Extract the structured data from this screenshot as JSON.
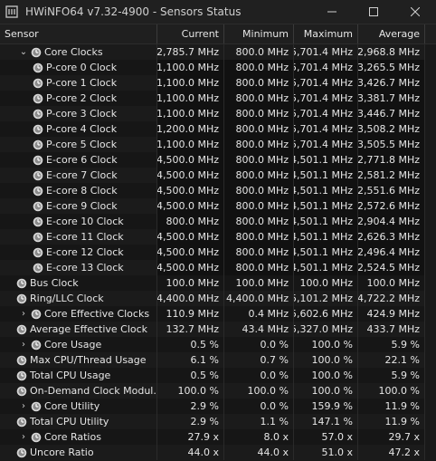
{
  "window": {
    "title": "HWiNFO64 v7.32-4900 - Sensors Status"
  },
  "columns": [
    "Sensor",
    "Current",
    "Minimum",
    "Maximum",
    "Average"
  ],
  "rows": [
    {
      "name": "Core Clocks",
      "cur": "2,785.7 MHz",
      "min": "800.0 MHz",
      "max": "5,701.4 MHz",
      "avg": "2,968.8 MHz",
      "indent": 1,
      "exp": "v",
      "icon": "clock"
    },
    {
      "name": "P-core 0 Clock",
      "cur": "1,100.0 MHz",
      "min": "800.0 MHz",
      "max": "5,701.4 MHz",
      "avg": "3,265.5 MHz",
      "indent": 2,
      "exp": "",
      "icon": "clock"
    },
    {
      "name": "P-core 1 Clock",
      "cur": "1,100.0 MHz",
      "min": "800.0 MHz",
      "max": "5,701.4 MHz",
      "avg": "3,426.7 MHz",
      "indent": 2,
      "exp": "",
      "icon": "clock"
    },
    {
      "name": "P-core 2 Clock",
      "cur": "1,100.0 MHz",
      "min": "800.0 MHz",
      "max": "5,701.4 MHz",
      "avg": "3,381.7 MHz",
      "indent": 2,
      "exp": "",
      "icon": "clock"
    },
    {
      "name": "P-core 3 Clock",
      "cur": "1,100.0 MHz",
      "min": "800.0 MHz",
      "max": "5,701.4 MHz",
      "avg": "3,446.7 MHz",
      "indent": 2,
      "exp": "",
      "icon": "clock"
    },
    {
      "name": "P-core 4 Clock",
      "cur": "1,200.0 MHz",
      "min": "800.0 MHz",
      "max": "5,701.4 MHz",
      "avg": "3,508.2 MHz",
      "indent": 2,
      "exp": "",
      "icon": "clock"
    },
    {
      "name": "P-core 5 Clock",
      "cur": "1,100.0 MHz",
      "min": "800.0 MHz",
      "max": "5,701.4 MHz",
      "avg": "3,505.5 MHz",
      "indent": 2,
      "exp": "",
      "icon": "clock"
    },
    {
      "name": "E-core 6 Clock",
      "cur": "4,500.0 MHz",
      "min": "800.0 MHz",
      "max": "4,501.1 MHz",
      "avg": "2,771.8 MHz",
      "indent": 2,
      "exp": "",
      "icon": "clock"
    },
    {
      "name": "E-core 7 Clock",
      "cur": "4,500.0 MHz",
      "min": "800.0 MHz",
      "max": "4,501.1 MHz",
      "avg": "2,581.2 MHz",
      "indent": 2,
      "exp": "",
      "icon": "clock"
    },
    {
      "name": "E-core 8 Clock",
      "cur": "4,500.0 MHz",
      "min": "800.0 MHz",
      "max": "4,501.1 MHz",
      "avg": "2,551.6 MHz",
      "indent": 2,
      "exp": "",
      "icon": "clock"
    },
    {
      "name": "E-core 9 Clock",
      "cur": "4,500.0 MHz",
      "min": "800.0 MHz",
      "max": "4,501.1 MHz",
      "avg": "2,572.6 MHz",
      "indent": 2,
      "exp": "",
      "icon": "clock"
    },
    {
      "name": "E-core 10 Clock",
      "cur": "800.0 MHz",
      "min": "800.0 MHz",
      "max": "4,501.1 MHz",
      "avg": "2,904.4 MHz",
      "indent": 2,
      "exp": "",
      "icon": "clock"
    },
    {
      "name": "E-core 11 Clock",
      "cur": "4,500.0 MHz",
      "min": "800.0 MHz",
      "max": "4,501.1 MHz",
      "avg": "2,626.3 MHz",
      "indent": 2,
      "exp": "",
      "icon": "clock"
    },
    {
      "name": "E-core 12 Clock",
      "cur": "4,500.0 MHz",
      "min": "800.0 MHz",
      "max": "4,501.1 MHz",
      "avg": "2,496.4 MHz",
      "indent": 2,
      "exp": "",
      "icon": "clock"
    },
    {
      "name": "E-core 13 Clock",
      "cur": "4,500.0 MHz",
      "min": "800.0 MHz",
      "max": "4,501.1 MHz",
      "avg": "2,524.5 MHz",
      "indent": 2,
      "exp": "",
      "icon": "clock"
    },
    {
      "name": "Bus Clock",
      "cur": "100.0 MHz",
      "min": "100.0 MHz",
      "max": "100.0 MHz",
      "avg": "100.0 MHz",
      "indent": 0,
      "exp": "",
      "icon": "clock"
    },
    {
      "name": "Ring/LLC Clock",
      "cur": "4,400.0 MHz",
      "min": "4,400.0 MHz",
      "max": "5,101.2 MHz",
      "avg": "4,722.2 MHz",
      "indent": 0,
      "exp": "",
      "icon": "clock"
    },
    {
      "name": "Core Effective Clocks",
      "cur": "110.9 MHz",
      "min": "0.4 MHz",
      "max": "5,602.6 MHz",
      "avg": "424.9 MHz",
      "indent": 1,
      "exp": ">",
      "icon": "clock"
    },
    {
      "name": "Average Effective Clock",
      "cur": "132.7 MHz",
      "min": "43.4 MHz",
      "max": "5,327.0 MHz",
      "avg": "433.7 MHz",
      "indent": 0,
      "exp": "",
      "icon": "clock"
    },
    {
      "name": "Core Usage",
      "cur": "0.5 %",
      "min": "0.0 %",
      "max": "100.0 %",
      "avg": "5.9 %",
      "indent": 1,
      "exp": ">",
      "icon": "clock"
    },
    {
      "name": "Max CPU/Thread Usage",
      "cur": "6.1 %",
      "min": "0.7 %",
      "max": "100.0 %",
      "avg": "22.1 %",
      "indent": 0,
      "exp": "",
      "icon": "clock"
    },
    {
      "name": "Total CPU Usage",
      "cur": "0.5 %",
      "min": "0.0 %",
      "max": "100.0 %",
      "avg": "5.9 %",
      "indent": 0,
      "exp": "",
      "icon": "clock"
    },
    {
      "name": "On-Demand Clock Modul...",
      "cur": "100.0 %",
      "min": "100.0 %",
      "max": "100.0 %",
      "avg": "100.0 %",
      "indent": 0,
      "exp": "",
      "icon": "clock"
    },
    {
      "name": "Core Utility",
      "cur": "2.9 %",
      "min": "0.0 %",
      "max": "159.9 %",
      "avg": "11.9 %",
      "indent": 1,
      "exp": ">",
      "icon": "clock"
    },
    {
      "name": "Total CPU Utility",
      "cur": "2.9 %",
      "min": "1.1 %",
      "max": "147.1 %",
      "avg": "11.9 %",
      "indent": 0,
      "exp": "",
      "icon": "clock"
    },
    {
      "name": "Core Ratios",
      "cur": "27.9 x",
      "min": "8.0 x",
      "max": "57.0 x",
      "avg": "29.7 x",
      "indent": 1,
      "exp": ">",
      "icon": "clock"
    },
    {
      "name": "Uncore Ratio",
      "cur": "44.0 x",
      "min": "44.0 x",
      "max": "51.0 x",
      "avg": "47.2 x",
      "indent": 0,
      "exp": "",
      "icon": "clock"
    }
  ]
}
